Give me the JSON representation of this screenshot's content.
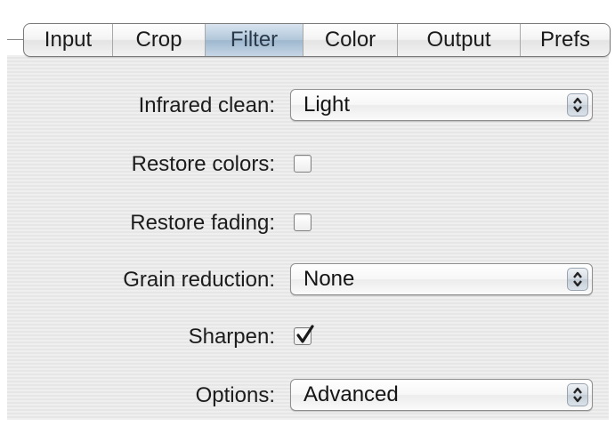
{
  "tabs": [
    {
      "label": "Input",
      "selected": false
    },
    {
      "label": "Crop",
      "selected": false
    },
    {
      "label": "Filter",
      "selected": true
    },
    {
      "label": "Color",
      "selected": false
    },
    {
      "label": "Output",
      "selected": false
    },
    {
      "label": "Prefs",
      "selected": false
    }
  ],
  "form": {
    "infrared_clean": {
      "label": "Infrared clean:",
      "value": "Light"
    },
    "restore_colors": {
      "label": "Restore colors:",
      "checked": false
    },
    "restore_fading": {
      "label": "Restore fading:",
      "checked": false
    },
    "grain_reduction": {
      "label": "Grain reduction:",
      "value": "None"
    },
    "sharpen": {
      "label": "Sharpen:",
      "checked": true
    },
    "options": {
      "label": "Options:",
      "value": "Advanced"
    }
  },
  "icons": {
    "popup_arrows": "up-down-chevron-icon",
    "checkmark": "checkmark-icon"
  },
  "colors": {
    "selected_tab": "#b3c8db",
    "panel_bg": "#ececec"
  }
}
